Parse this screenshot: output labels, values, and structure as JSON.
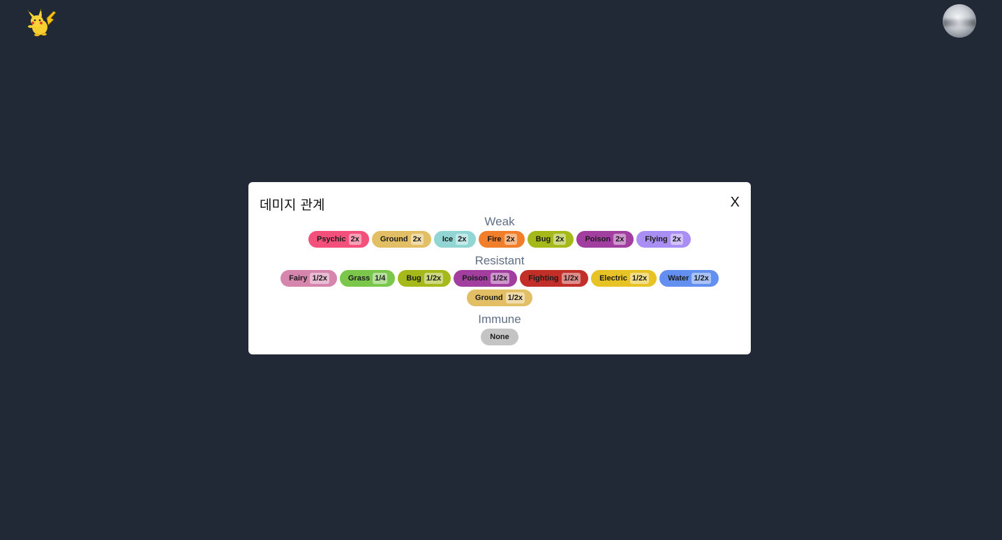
{
  "header": {
    "logo_icon": "pikachu-icon",
    "avatar_icon": "user-avatar"
  },
  "modal": {
    "title": "데미지 관계",
    "close_label": "X",
    "weak": {
      "title": "Weak",
      "items": [
        {
          "type": "Psychic",
          "mult": "2x",
          "color": "#f4507c"
        },
        {
          "type": "Ground",
          "mult": "2x",
          "color": "#e2bf65"
        },
        {
          "type": "Ice",
          "mult": "2x",
          "color": "#91d5d4"
        },
        {
          "type": "Fire",
          "mult": "2x",
          "color": "#f07e2a"
        },
        {
          "type": "Bug",
          "mult": "2x",
          "color": "#a6b91a"
        },
        {
          "type": "Poison",
          "mult": "2x",
          "color": "#a33ea1"
        },
        {
          "type": "Flying",
          "mult": "2x",
          "color": "#a98ff3"
        }
      ]
    },
    "resistant": {
      "title": "Resistant",
      "rows": [
        [
          {
            "type": "Fairy",
            "mult": "1/2x",
            "color": "#d685ad"
          },
          {
            "type": "Grass",
            "mult": "1/4",
            "color": "#7ac74c"
          },
          {
            "type": "Bug",
            "mult": "1/2x",
            "color": "#a6b91a"
          },
          {
            "type": "Poison",
            "mult": "1/2x",
            "color": "#a33ea1"
          },
          {
            "type": "Fighting",
            "mult": "1/2x",
            "color": "#c22e28"
          },
          {
            "type": "Electric",
            "mult": "1/2x",
            "color": "#e8c325"
          },
          {
            "type": "Water",
            "mult": "1/2x",
            "color": "#6390f0"
          }
        ],
        [
          {
            "type": "Ground",
            "mult": "1/2x",
            "color": "#e2bf65"
          }
        ]
      ]
    },
    "immune": {
      "title": "Immune",
      "items": [
        {
          "type": "None",
          "color": "#c4c4c4"
        }
      ]
    }
  }
}
